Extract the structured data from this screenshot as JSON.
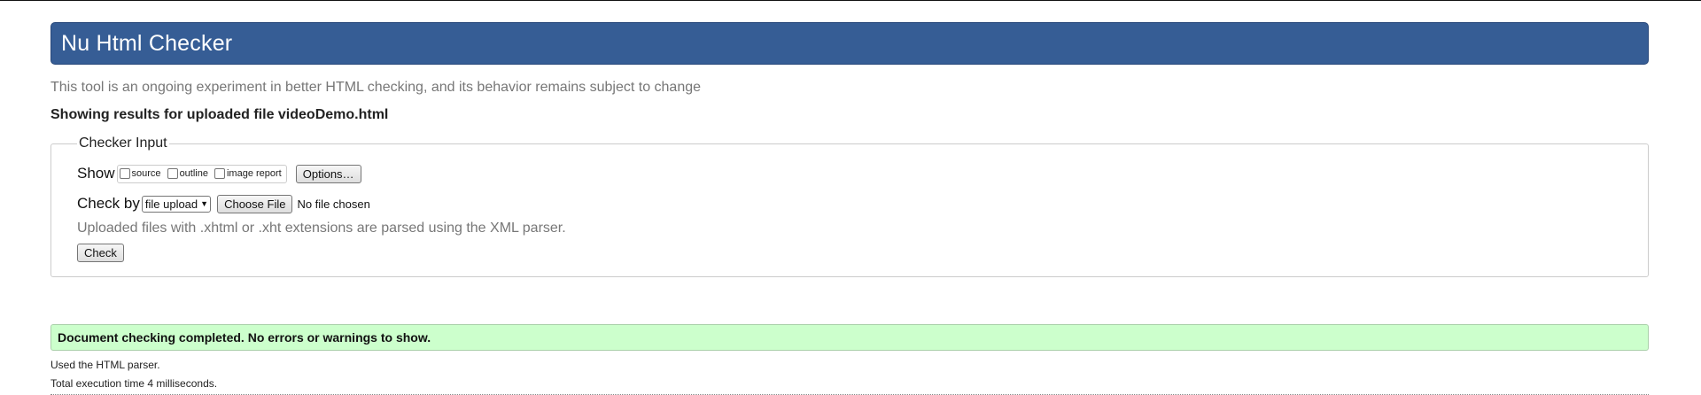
{
  "header": {
    "title": "Nu Html Checker"
  },
  "tagline": "This tool is an ongoing experiment in better HTML checking, and its behavior remains subject to change",
  "results_for": "Showing results for uploaded file videoDemo.html",
  "checker_input": {
    "legend": "Checker Input",
    "show": {
      "label": "Show",
      "options": [
        {
          "label": "source",
          "checked": false
        },
        {
          "label": "outline",
          "checked": false
        },
        {
          "label": "image report",
          "checked": false
        }
      ],
      "options_button": "Options…"
    },
    "check_by": {
      "label": "Check by",
      "selected": "file upload",
      "choose_file_button": "Choose File",
      "file_status": "No file chosen"
    },
    "note": "Uploaded files with .xhtml or .xht extensions are parsed using the XML parser.",
    "check_button": "Check"
  },
  "result": {
    "message": "Document checking completed. No errors or warnings to show.",
    "parser_info": "Used the HTML parser.",
    "execution_time": "Total execution time 4 milliseconds."
  },
  "icons": {
    "select_chevron": "chevron-down-icon"
  },
  "colors": {
    "header_bg": "#365d95",
    "success_bg": "#ccffcc",
    "muted_text": "#777777"
  }
}
